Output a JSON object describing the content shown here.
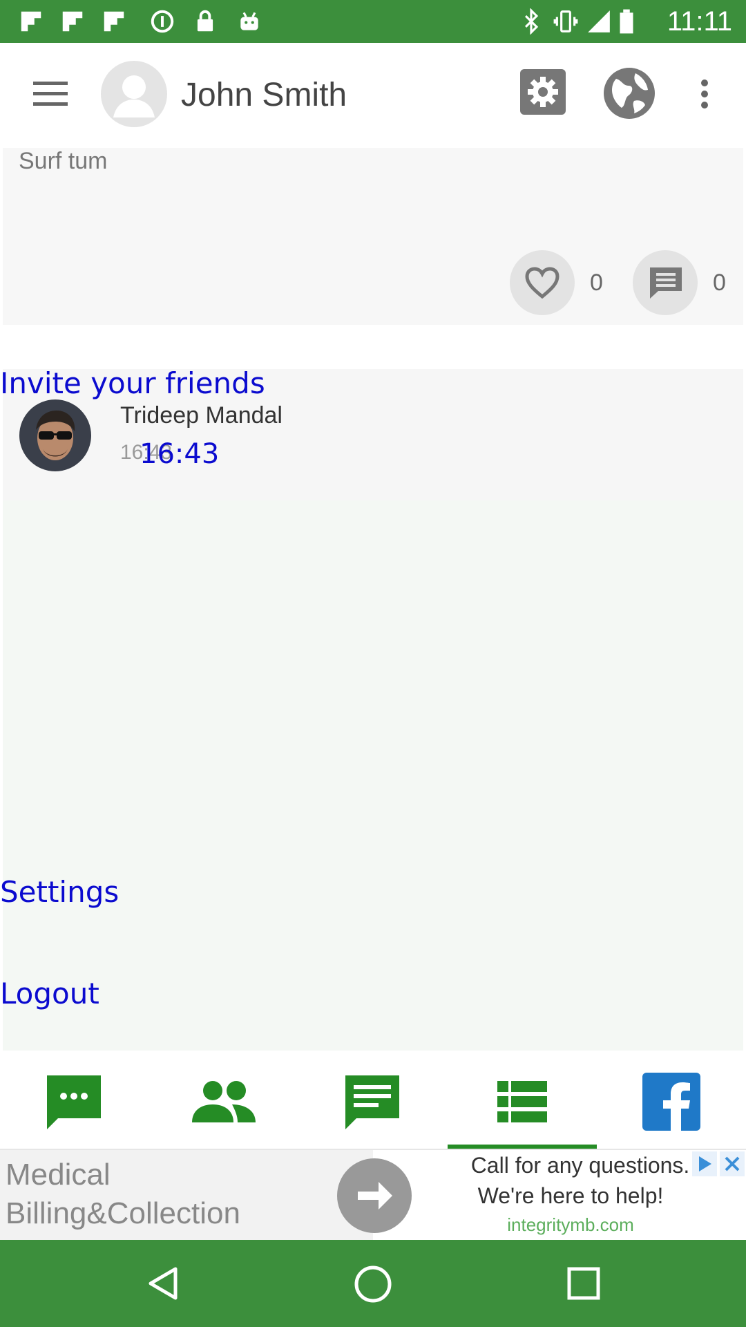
{
  "status_bar": {
    "time": "11:11",
    "left_icons": [
      "flipboard-icon",
      "flipboard-icon",
      "flipboard-icon",
      "data-saver-icon",
      "lock-icon",
      "android-icon"
    ],
    "right_icons": [
      "bluetooth-icon",
      "vibrate-icon",
      "signal-icon",
      "battery-icon"
    ]
  },
  "header": {
    "user_name": "John Smith",
    "icons": [
      "menu-icon",
      "avatar-placeholder-icon",
      "settings-icon",
      "globe-icon",
      "more-vert-icon"
    ]
  },
  "post": {
    "text": "Surf tum",
    "like_count": "0",
    "comment_count": "0"
  },
  "drawer": {
    "invite_label": "Invite your friends",
    "contact_name": "Trideep Mandal",
    "contact_time_faded": "16:43",
    "contact_time": "16:43",
    "settings_label": "Settings",
    "logout_label": "Logout"
  },
  "tabs": {
    "items": [
      "chat-icon",
      "people-icon",
      "messages-icon",
      "list-icon",
      "facebook-icon"
    ],
    "active_index": 3
  },
  "ad": {
    "title_line1": "Medical",
    "title_line2": "Billing&Collection",
    "line1": "Call for any questions.",
    "line2": "We're here to help!",
    "domain": "integritymb.com"
  },
  "colors": {
    "green": "#3c8f3c",
    "link_blue": "#0b0bcf",
    "tab_green": "#258c25"
  }
}
